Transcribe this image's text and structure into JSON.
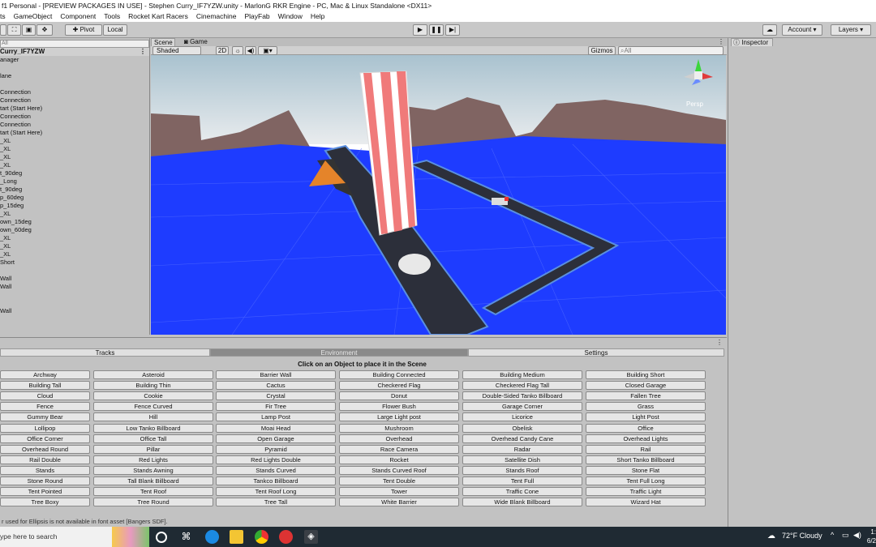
{
  "window": {
    "title": "f1 Personal - [PREVIEW PACKAGES IN USE] - Stephen Curry_IF7YZW.unity - MarlonG RKR Engine - PC, Mac & Linux Standalone <DX11>"
  },
  "menu": [
    "ts",
    "GameObject",
    "Component",
    "Tools",
    "Rocket Kart Racers",
    "Cinemachine",
    "PlayFab",
    "Window",
    "Help"
  ],
  "toolbar": {
    "pivot_label": "Pivot",
    "local_label": "Local",
    "account_label": "Account",
    "layers_label": "Layers"
  },
  "hierarchy": {
    "search_placeholder": "All",
    "scene_name": "Curry_IF7YZW",
    "items": [
      "anager",
      "",
      "lane",
      "",
      "Connection",
      "Connection",
      "tart (Start Here)",
      "Connection",
      "Connection",
      "tart (Start Here)",
      "_XL",
      "_XL",
      "_XL",
      "_XL",
      "t_90deg",
      "_Long",
      "t_90deg",
      "p_60deg",
      "p_15deg",
      "_XL",
      "own_15deg",
      "own_60deg",
      "_XL",
      "_XL",
      "_XL",
      "Short",
      "",
      "Wall",
      "Wall",
      "",
      "",
      "Wall"
    ]
  },
  "scene": {
    "tab_scene": "Scene",
    "tab_game": "Game",
    "shading": "Shaded",
    "mode_2d": "2D",
    "gizmos": "Gizmos",
    "search_placeholder": "All",
    "persp_label": "Persp"
  },
  "inspector": {
    "tab_label": "Inspector"
  },
  "builder": {
    "tabs": [
      "Tracks",
      "Environment",
      "Settings"
    ],
    "active_tab": "Environment",
    "instruction": "Click on an Object to place it in the Scene",
    "objects": [
      "Archway",
      "Asteroid",
      "Barrier Wall",
      "Building Connected",
      "Building Medium",
      "Building Short",
      "Building Tall",
      "Building Thin",
      "Cactus",
      "Checkered Flag",
      "Checkered Flag Tall",
      "Closed Garage",
      "Cloud",
      "Cookie",
      "Crystal",
      "Donut",
      "Double-Sided Tanko Billboard",
      "Fallen Tree",
      "Fence",
      "Fence Curved",
      "Fir Tree",
      "Flower Bush",
      "Garage Corner",
      "Grass",
      "Gummy Bear",
      "Hill",
      "Lamp Post",
      "Large Light post",
      "Licorice",
      "Light Post",
      "Lollipop",
      "Low Tanko Billboard",
      "Moai Head",
      "Mushroom",
      "Obelisk",
      "Office",
      "Office Corner",
      "Office Tall",
      "Open Garage",
      "Overhead",
      "Overhead Candy Cane",
      "Overhead Lights",
      "Overhead Round",
      "Pillar",
      "Pyramid",
      "Race Camera",
      "Radar",
      "Rail",
      "Rail Double",
      "Red Lights",
      "Red Lights Double",
      "Rocket",
      "Satellite Dish",
      "Short Tanko Billboard",
      "Stands",
      "Stands Awning",
      "Stands Curved",
      "Stands Curved Roof",
      "Stands Roof",
      "Stone Flat",
      "Stone Round",
      "Tall Blank Billboard",
      "Tankco Billboard",
      "Tent Double",
      "Tent Full",
      "Tent Full Long",
      "Tent Pointed",
      "Tent Roof",
      "Tent Roof Long",
      "Tower",
      "Traffic Cone",
      "Traffic Light",
      "Tree Boxy",
      "Tree Round",
      "Tree Tall",
      "White Barrier",
      "Wide Blank Billboard",
      "Wizard Hat"
    ]
  },
  "status": {
    "message": "r used for Ellipsis is not available in font asset [Bangers SDF]."
  },
  "taskbar": {
    "search_placeholder": "ype here to search",
    "weather": "72°F  Cloudy",
    "time": "1:",
    "date": "6/2"
  },
  "colors": {
    "sky": "#a9c2cf",
    "ground": "#1e3cff",
    "track": "#2c2f3a"
  }
}
